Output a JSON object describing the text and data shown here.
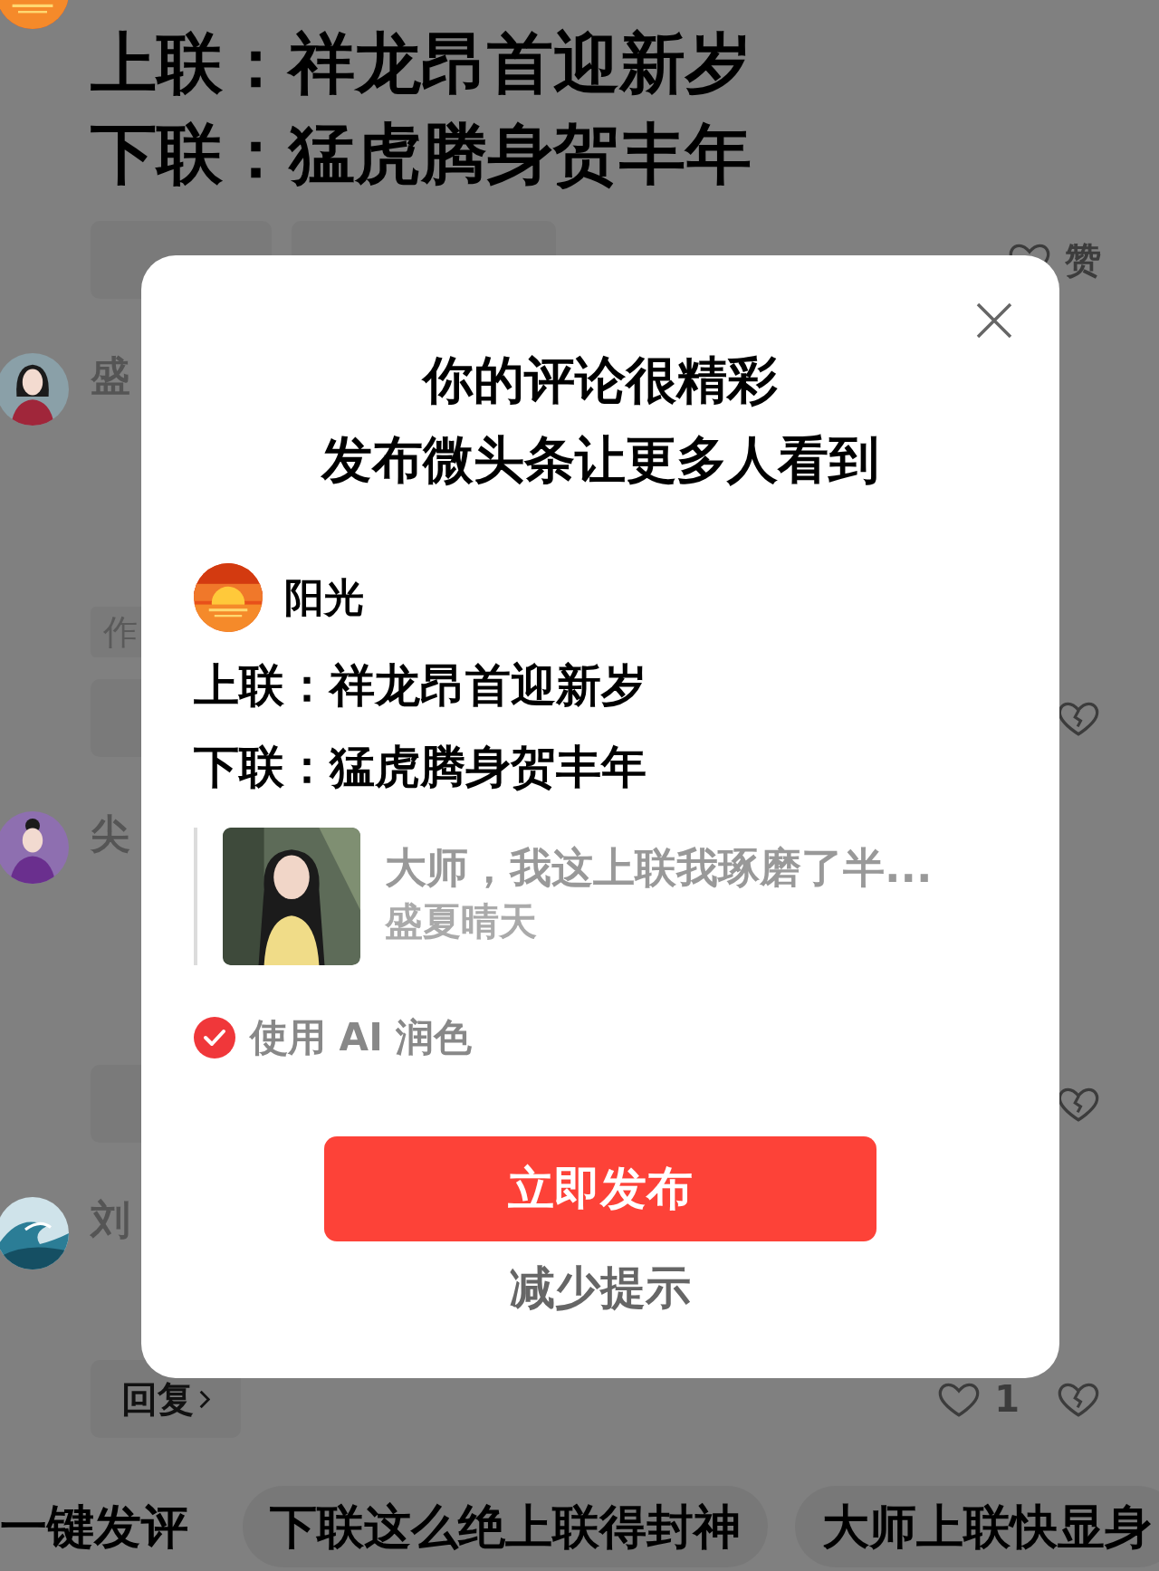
{
  "feed": [
    {
      "kind": "full",
      "lines": [
        "上联：祥龙昂首迎新岁",
        "下联：猛虎腾身贺丰年"
      ],
      "reactions": [
        {
          "kind": "like",
          "label": "赞"
        }
      ]
    },
    {
      "kind": "clipped",
      "name": "盛",
      "tag": "作",
      "reactions": [
        {
          "kind": "dislike"
        }
      ]
    },
    {
      "kind": "clipped",
      "name": "尖",
      "reactions": [
        {
          "kind": "dislike"
        }
      ]
    },
    {
      "kind": "clipped",
      "name": "刘",
      "actions": [
        {
          "label": "回复",
          "chevron": true
        }
      ],
      "reactions": [
        {
          "kind": "like",
          "label": "1"
        },
        {
          "kind": "dislike"
        }
      ]
    }
  ],
  "suggestions": [
    "一键发评",
    "下联这么绝上联得封神",
    "大师上联快显身"
  ],
  "dialog": {
    "title_lines": [
      "你的评论很精彩",
      "发布微头条让更多人看到"
    ],
    "author": "阳光",
    "lines": [
      "上联：祥龙昂首迎新岁",
      "下联：猛虎腾身贺丰年"
    ],
    "quote": {
      "text": "大师，我这上联我琢磨了半...",
      "author": "盛夏晴天"
    },
    "ai_polish": {
      "label": "使用 AI 润色",
      "checked": true
    },
    "primary_button": "立即发布",
    "secondary_link": "减少提示"
  }
}
